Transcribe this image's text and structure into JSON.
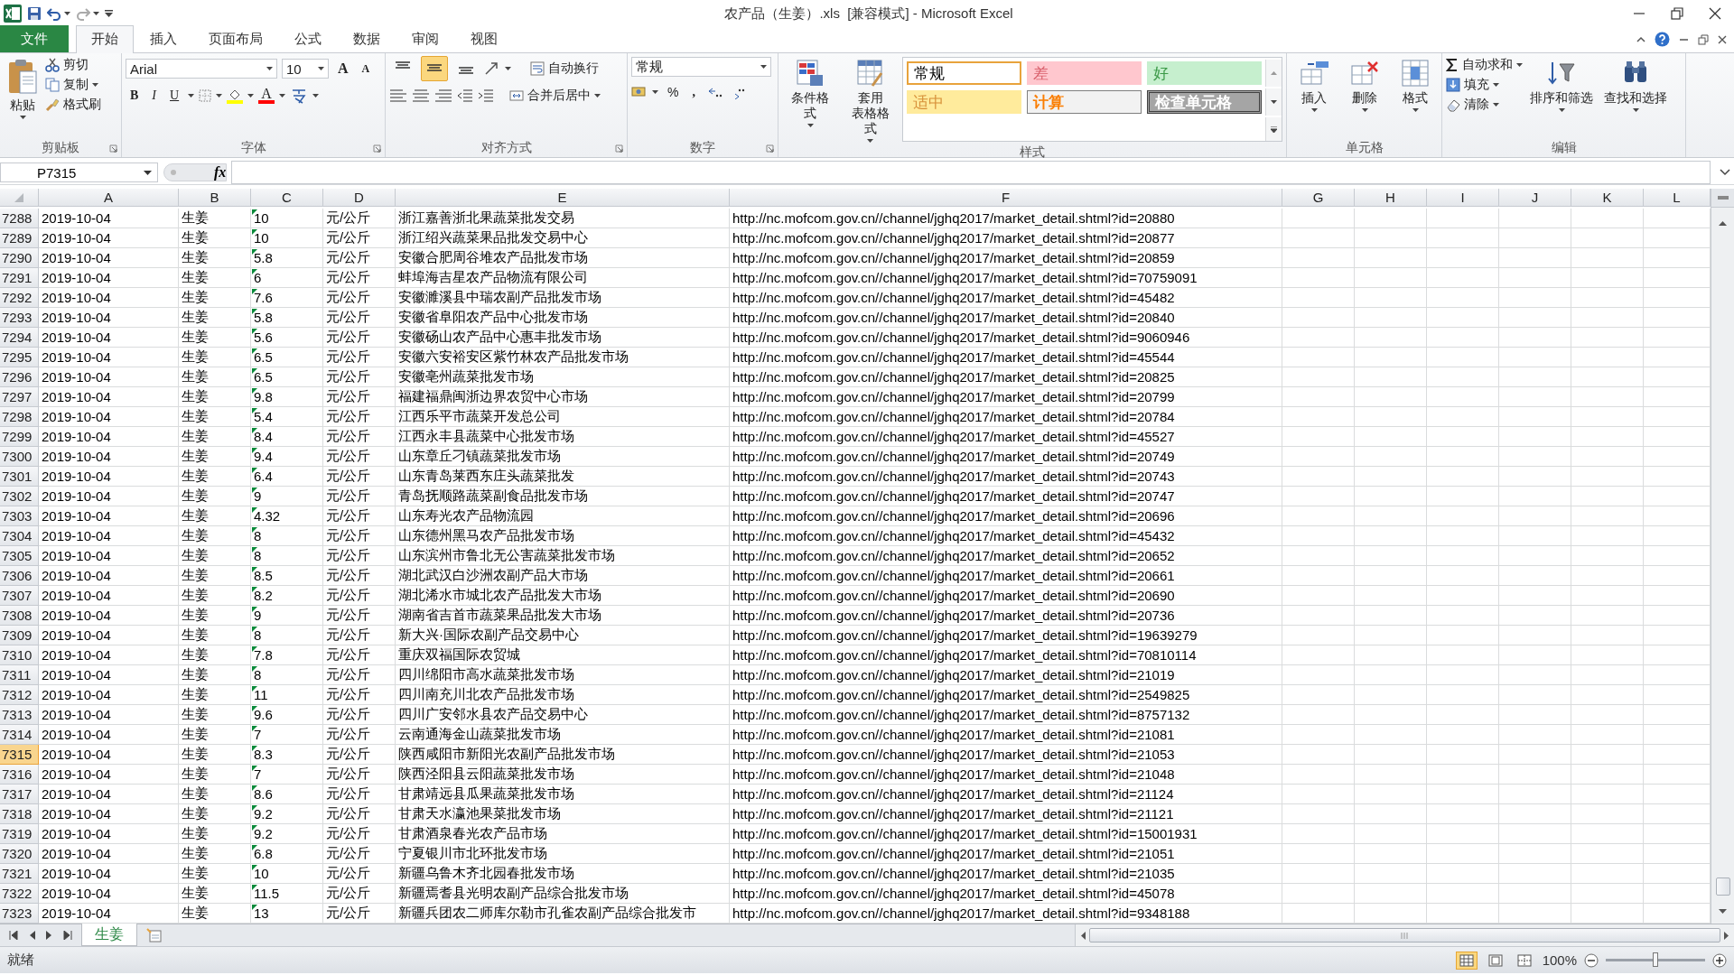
{
  "quick_access": {
    "title": "农产品（生姜）.xls  [兼容模式] - Microsoft Excel"
  },
  "menu_tabs": [
    {
      "label": "文件",
      "kind": "file",
      "selected": false
    },
    {
      "label": "开始",
      "kind": "tab",
      "selected": true
    },
    {
      "label": "插入",
      "kind": "tab",
      "selected": false
    },
    {
      "label": "页面布局",
      "kind": "tab",
      "selected": false
    },
    {
      "label": "公式",
      "kind": "tab",
      "selected": false
    },
    {
      "label": "数据",
      "kind": "tab",
      "selected": false
    },
    {
      "label": "审阅",
      "kind": "tab",
      "selected": false
    },
    {
      "label": "视图",
      "kind": "tab",
      "selected": false
    }
  ],
  "ribbon": [
    {
      "kind": "clipboard",
      "label": "剪贴板",
      "launcher": true,
      "paste": "粘贴",
      "cut": "剪切",
      "copy": "复制",
      "format_painter": "格式刷"
    },
    {
      "kind": "font",
      "label": "字体",
      "launcher": true,
      "font_name": "Arial",
      "font_size": "10",
      "grow": "A",
      "shrink": "A",
      "bold": "B",
      "italic": "I",
      "underline": "U",
      "font_color": "A"
    },
    {
      "kind": "alignment",
      "label": "对齐方式",
      "launcher": true,
      "vertical_align": [
        {
          "selected": false
        },
        {
          "selected": true
        },
        {
          "selected": false
        }
      ],
      "wrap_text": "自动换行",
      "merge_center": "合并后居中"
    },
    {
      "kind": "number",
      "label": "数字",
      "launcher": true,
      "format": "常规",
      "percent": "%",
      "comma": ","
    },
    {
      "kind": "styles",
      "label": "样式",
      "launcher": false,
      "conditional_format": "条件格式",
      "table_format": [
        "套用",
        "表格格式"
      ],
      "cell_styles": [
        {
          "label": "常规",
          "kind": "normal",
          "color": "#ffffff",
          "selected": true
        },
        {
          "label": "差",
          "kind": "bad",
          "color": "#ffc7ce",
          "selected": false
        },
        {
          "label": "好",
          "kind": "good",
          "color": "#c6efce",
          "selected": false
        },
        {
          "label": "适中",
          "kind": "neutral",
          "color": "#ffeb9c",
          "selected": false
        },
        {
          "label": "计算",
          "kind": "calc",
          "color": "#f2f2f2",
          "selected": false
        },
        {
          "label": "检查单元格",
          "kind": "check",
          "color": "#a5a5a5",
          "selected": false
        }
      ]
    },
    {
      "kind": "cells",
      "label": "单元格",
      "launcher": false,
      "buttons": [
        "插入",
        "删除",
        "格式"
      ]
    },
    {
      "kind": "editing",
      "label": "编辑",
      "launcher": false,
      "autosum": "自动求和",
      "fill": "填充",
      "clear": "清除",
      "sort_filter": "排序和筛选",
      "find_select": "查找和选择"
    }
  ],
  "formula_bar": {
    "name_box": "P7315",
    "function_button": "fx"
  },
  "sheet": {
    "text_number_warning": true,
    "columns": [
      "A",
      "B",
      "C",
      "D",
      "E",
      "F",
      "G",
      "H",
      "I",
      "J",
      "K",
      "L"
    ],
    "rows": [
      {
        "row": "7288",
        "selected": false,
        "cells": [
          "2019-10-04",
          "生姜",
          "10",
          "元/公斤",
          "浙江嘉善浙北果蔬菜批发交易",
          "http://nc.mofcom.gov.cn//channel/jghq2017/market_detail.shtml?id=20880"
        ]
      },
      {
        "row": "7289",
        "selected": false,
        "cells": [
          "2019-10-04",
          "生姜",
          "10",
          "元/公斤",
          "浙江绍兴蔬菜果品批发交易中心",
          "http://nc.mofcom.gov.cn//channel/jghq2017/market_detail.shtml?id=20877"
        ]
      },
      {
        "row": "7290",
        "selected": false,
        "cells": [
          "2019-10-04",
          "生姜",
          "5.8",
          "元/公斤",
          "安徽合肥周谷堆农产品批发市场",
          "http://nc.mofcom.gov.cn//channel/jghq2017/market_detail.shtml?id=20859"
        ]
      },
      {
        "row": "7291",
        "selected": false,
        "cells": [
          "2019-10-04",
          "生姜",
          "6",
          "元/公斤",
          "蚌埠海吉星农产品物流有限公司",
          "http://nc.mofcom.gov.cn//channel/jghq2017/market_detail.shtml?id=70759091"
        ]
      },
      {
        "row": "7292",
        "selected": false,
        "cells": [
          "2019-10-04",
          "生姜",
          "7.6",
          "元/公斤",
          "安徽濉溪县中瑞农副产品批发市场",
          "http://nc.mofcom.gov.cn//channel/jghq2017/market_detail.shtml?id=45482"
        ]
      },
      {
        "row": "7293",
        "selected": false,
        "cells": [
          "2019-10-04",
          "生姜",
          "5.8",
          "元/公斤",
          "安徽省阜阳农产品中心批发市场",
          "http://nc.mofcom.gov.cn//channel/jghq2017/market_detail.shtml?id=20840"
        ]
      },
      {
        "row": "7294",
        "selected": false,
        "cells": [
          "2019-10-04",
          "生姜",
          "5.6",
          "元/公斤",
          "安徽砀山农产品中心惠丰批发市场",
          "http://nc.mofcom.gov.cn//channel/jghq2017/market_detail.shtml?id=9060946"
        ]
      },
      {
        "row": "7295",
        "selected": false,
        "cells": [
          "2019-10-04",
          "生姜",
          "6.5",
          "元/公斤",
          "安徽六安裕安区紫竹林农产品批发市场",
          "http://nc.mofcom.gov.cn//channel/jghq2017/market_detail.shtml?id=45544"
        ]
      },
      {
        "row": "7296",
        "selected": false,
        "cells": [
          "2019-10-04",
          "生姜",
          "6.5",
          "元/公斤",
          "安徽亳州蔬菜批发市场",
          "http://nc.mofcom.gov.cn//channel/jghq2017/market_detail.shtml?id=20825"
        ]
      },
      {
        "row": "7297",
        "selected": false,
        "cells": [
          "2019-10-04",
          "生姜",
          "9.8",
          "元/公斤",
          "福建福鼎闽浙边界农贸中心市场",
          "http://nc.mofcom.gov.cn//channel/jghq2017/market_detail.shtml?id=20799"
        ]
      },
      {
        "row": "7298",
        "selected": false,
        "cells": [
          "2019-10-04",
          "生姜",
          "5.4",
          "元/公斤",
          "江西乐平市蔬菜开发总公司",
          "http://nc.mofcom.gov.cn//channel/jghq2017/market_detail.shtml?id=20784"
        ]
      },
      {
        "row": "7299",
        "selected": false,
        "cells": [
          "2019-10-04",
          "生姜",
          "8.4",
          "元/公斤",
          "江西永丰县蔬菜中心批发市场",
          "http://nc.mofcom.gov.cn//channel/jghq2017/market_detail.shtml?id=45527"
        ]
      },
      {
        "row": "7300",
        "selected": false,
        "cells": [
          "2019-10-04",
          "生姜",
          "9.4",
          "元/公斤",
          "山东章丘刁镇蔬菜批发市场",
          "http://nc.mofcom.gov.cn//channel/jghq2017/market_detail.shtml?id=20749"
        ]
      },
      {
        "row": "7301",
        "selected": false,
        "cells": [
          "2019-10-04",
          "生姜",
          "6.4",
          "元/公斤",
          "山东青岛莱西东庄头蔬菜批发",
          "http://nc.mofcom.gov.cn//channel/jghq2017/market_detail.shtml?id=20743"
        ]
      },
      {
        "row": "7302",
        "selected": false,
        "cells": [
          "2019-10-04",
          "生姜",
          "9",
          "元/公斤",
          "青岛抚顺路蔬菜副食品批发市场",
          "http://nc.mofcom.gov.cn//channel/jghq2017/market_detail.shtml?id=20747"
        ]
      },
      {
        "row": "7303",
        "selected": false,
        "cells": [
          "2019-10-04",
          "生姜",
          "4.32",
          "元/公斤",
          "山东寿光农产品物流园",
          "http://nc.mofcom.gov.cn//channel/jghq2017/market_detail.shtml?id=20696"
        ]
      },
      {
        "row": "7304",
        "selected": false,
        "cells": [
          "2019-10-04",
          "生姜",
          "8",
          "元/公斤",
          "山东德州黑马农产品批发市场",
          "http://nc.mofcom.gov.cn//channel/jghq2017/market_detail.shtml?id=45432"
        ]
      },
      {
        "row": "7305",
        "selected": false,
        "cells": [
          "2019-10-04",
          "生姜",
          "8",
          "元/公斤",
          "山东滨州市鲁北无公害蔬菜批发市场",
          "http://nc.mofcom.gov.cn//channel/jghq2017/market_detail.shtml?id=20652"
        ]
      },
      {
        "row": "7306",
        "selected": false,
        "cells": [
          "2019-10-04",
          "生姜",
          "8.5",
          "元/公斤",
          "湖北武汉白沙洲农副产品大市场",
          "http://nc.mofcom.gov.cn//channel/jghq2017/market_detail.shtml?id=20661"
        ]
      },
      {
        "row": "7307",
        "selected": false,
        "cells": [
          "2019-10-04",
          "生姜",
          "8.2",
          "元/公斤",
          "湖北浠水市城北农产品批发大市场",
          "http://nc.mofcom.gov.cn//channel/jghq2017/market_detail.shtml?id=20690"
        ]
      },
      {
        "row": "7308",
        "selected": false,
        "cells": [
          "2019-10-04",
          "生姜",
          "9",
          "元/公斤",
          "湖南省吉首市蔬菜果品批发大市场",
          "http://nc.mofcom.gov.cn//channel/jghq2017/market_detail.shtml?id=20736"
        ]
      },
      {
        "row": "7309",
        "selected": false,
        "cells": [
          "2019-10-04",
          "生姜",
          "8",
          "元/公斤",
          "新大兴·国际农副产品交易中心",
          "http://nc.mofcom.gov.cn//channel/jghq2017/market_detail.shtml?id=19639279"
        ]
      },
      {
        "row": "7310",
        "selected": false,
        "cells": [
          "2019-10-04",
          "生姜",
          "7.8",
          "元/公斤",
          "重庆双福国际农贸城",
          "http://nc.mofcom.gov.cn//channel/jghq2017/market_detail.shtml?id=70810114"
        ]
      },
      {
        "row": "7311",
        "selected": false,
        "cells": [
          "2019-10-04",
          "生姜",
          "8",
          "元/公斤",
          "四川绵阳市高水蔬菜批发市场",
          "http://nc.mofcom.gov.cn//channel/jghq2017/market_detail.shtml?id=21019"
        ]
      },
      {
        "row": "7312",
        "selected": false,
        "cells": [
          "2019-10-04",
          "生姜",
          "11",
          "元/公斤",
          "四川南充川北农产品批发市场",
          "http://nc.mofcom.gov.cn//channel/jghq2017/market_detail.shtml?id=2549825"
        ]
      },
      {
        "row": "7313",
        "selected": false,
        "cells": [
          "2019-10-04",
          "生姜",
          "9.6",
          "元/公斤",
          "四川广安邻水县农产品交易中心",
          "http://nc.mofcom.gov.cn//channel/jghq2017/market_detail.shtml?id=8757132"
        ]
      },
      {
        "row": "7314",
        "selected": false,
        "cells": [
          "2019-10-04",
          "生姜",
          "7",
          "元/公斤",
          "云南通海金山蔬菜批发市场",
          "http://nc.mofcom.gov.cn//channel/jghq2017/market_detail.shtml?id=21081"
        ]
      },
      {
        "row": "7315",
        "selected": true,
        "cells": [
          "2019-10-04",
          "生姜",
          "8.3",
          "元/公斤",
          "陕西咸阳市新阳光农副产品批发市场",
          "http://nc.mofcom.gov.cn//channel/jghq2017/market_detail.shtml?id=21053"
        ]
      },
      {
        "row": "7316",
        "selected": false,
        "cells": [
          "2019-10-04",
          "生姜",
          "7",
          "元/公斤",
          "陕西泾阳县云阳蔬菜批发市场",
          "http://nc.mofcom.gov.cn//channel/jghq2017/market_detail.shtml?id=21048"
        ]
      },
      {
        "row": "7317",
        "selected": false,
        "cells": [
          "2019-10-04",
          "生姜",
          "8.6",
          "元/公斤",
          "甘肃靖远县瓜果蔬菜批发市场",
          "http://nc.mofcom.gov.cn//channel/jghq2017/market_detail.shtml?id=21124"
        ]
      },
      {
        "row": "7318",
        "selected": false,
        "cells": [
          "2019-10-04",
          "生姜",
          "9.2",
          "元/公斤",
          "甘肃天水瀛池果菜批发市场",
          "http://nc.mofcom.gov.cn//channel/jghq2017/market_detail.shtml?id=21121"
        ]
      },
      {
        "row": "7319",
        "selected": false,
        "cells": [
          "2019-10-04",
          "生姜",
          "9.2",
          "元/公斤",
          "甘肃酒泉春光农产品市场",
          "http://nc.mofcom.gov.cn//channel/jghq2017/market_detail.shtml?id=15001931"
        ]
      },
      {
        "row": "7320",
        "selected": false,
        "cells": [
          "2019-10-04",
          "生姜",
          "6.8",
          "元/公斤",
          "宁夏银川市北环批发市场",
          "http://nc.mofcom.gov.cn//channel/jghq2017/market_detail.shtml?id=21051"
        ]
      },
      {
        "row": "7321",
        "selected": false,
        "cells": [
          "2019-10-04",
          "生姜",
          "10",
          "元/公斤",
          "新疆乌鲁木齐北园春批发市场",
          "http://nc.mofcom.gov.cn//channel/jghq2017/market_detail.shtml?id=21035"
        ]
      },
      {
        "row": "7322",
        "selected": false,
        "cells": [
          "2019-10-04",
          "生姜",
          "11.5",
          "元/公斤",
          "新疆焉耆县光明农副产品综合批发市场",
          "http://nc.mofcom.gov.cn//channel/jghq2017/market_detail.shtml?id=45078"
        ]
      },
      {
        "row": "7323",
        "selected": false,
        "cells": [
          "2019-10-04",
          "生姜",
          "13",
          "元/公斤",
          "新疆兵团农二师库尔勒市孔雀农副产品综合批发市",
          "http://nc.mofcom.gov.cn//channel/jghq2017/market_detail.shtml?id=9348188"
        ]
      }
    ]
  },
  "sheet_tabs": [
    {
      "label": "生姜",
      "selected": true
    }
  ],
  "status_bar": {
    "text": "就绪",
    "views": [
      {
        "selected": true
      },
      {
        "selected": false
      },
      {
        "selected": false
      }
    ],
    "zoom": {
      "label": "100%",
      "level": 0.5
    }
  }
}
